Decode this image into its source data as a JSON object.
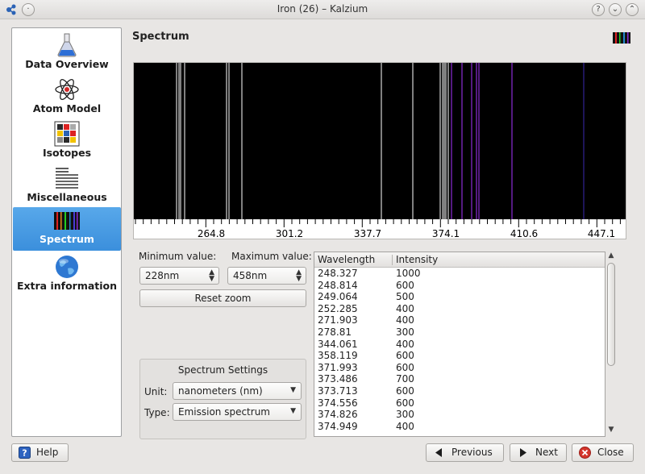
{
  "window": {
    "title": "Iron (26) – Kalzium"
  },
  "sidebar": {
    "items": [
      {
        "label": "Data Overview"
      },
      {
        "label": "Atom Model"
      },
      {
        "label": "Isotopes"
      },
      {
        "label": "Miscellaneous"
      },
      {
        "label": "Spectrum"
      },
      {
        "label": "Extra information"
      }
    ]
  },
  "main": {
    "heading": "Spectrum",
    "axis_labels": [
      "264.8",
      "301.2",
      "337.7",
      "374.1",
      "410.6",
      "447.1"
    ],
    "min_label": "Minimum value:",
    "max_label": "Maximum value:",
    "min_value": "228nm",
    "max_value": "458nm",
    "reset_zoom": "Reset zoom",
    "settings": {
      "title": "Spectrum Settings",
      "unit_label": "Unit:",
      "unit_value": "nanometers (nm)",
      "type_label": "Type:",
      "type_value": "Emission spectrum"
    },
    "table": {
      "col_wavelength": "Wavelength",
      "col_intensity": "Intensity",
      "rows": [
        {
          "w": "248.327",
          "i": "1000"
        },
        {
          "w": "248.814",
          "i": "600"
        },
        {
          "w": "249.064",
          "i": "500"
        },
        {
          "w": "252.285",
          "i": "400"
        },
        {
          "w": "271.903",
          "i": "400"
        },
        {
          "w": "278.81",
          "i": "300"
        },
        {
          "w": "344.061",
          "i": "400"
        },
        {
          "w": "358.119",
          "i": "600"
        },
        {
          "w": "371.993",
          "i": "600"
        },
        {
          "w": "373.486",
          "i": "700"
        },
        {
          "w": "373.713",
          "i": "600"
        },
        {
          "w": "374.556",
          "i": "600"
        },
        {
          "w": "374.826",
          "i": "300"
        },
        {
          "w": "374.949",
          "i": "400"
        }
      ]
    }
  },
  "footer": {
    "help": "Help",
    "previous": "Previous",
    "next": "Next",
    "close": "Close"
  },
  "colors": {
    "accent": "#3b8fdc",
    "spectrum_bg": "#000000",
    "line_violet": "#8b2bd6"
  }
}
